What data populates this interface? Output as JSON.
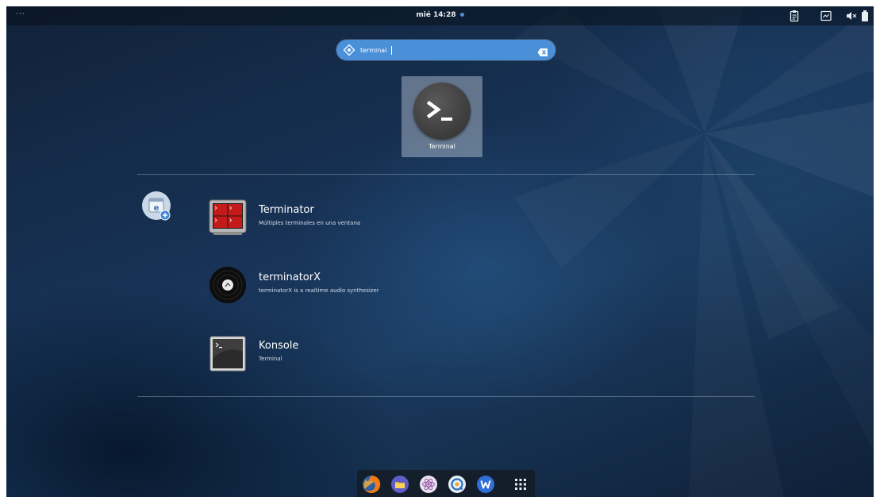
{
  "topbar": {
    "activities": "···",
    "clock": "mié 14:28",
    "tray_icons": [
      "clipboard-icon",
      "screenshot-icon",
      "volume-muted-icon",
      "battery-icon"
    ]
  },
  "search": {
    "value": "terminal",
    "icon": "search-icon",
    "clear_icon": "clear-icon"
  },
  "top_result": {
    "label": "Terminal",
    "icon": "terminal-icon"
  },
  "provider": {
    "icon": "software-provider-icon"
  },
  "results": [
    {
      "name": "Terminator",
      "description": "Múltiples terminales en una ventana",
      "icon": "terminator-icon"
    },
    {
      "name": "terminatorX",
      "description": "terminatorX is a realtime audio synthesizer",
      "icon": "terminatorx-icon"
    },
    {
      "name": "Konsole",
      "description": "Terminal",
      "icon": "konsole-icon"
    }
  ],
  "dash": {
    "items": [
      "firefox-icon",
      "files-icon",
      "atom-icon",
      "browser-icon",
      "wps-writer-icon",
      "app-grid-icon"
    ]
  },
  "colors": {
    "accent": "#4a90d9",
    "background": "#183458",
    "text": "#ffffff"
  }
}
